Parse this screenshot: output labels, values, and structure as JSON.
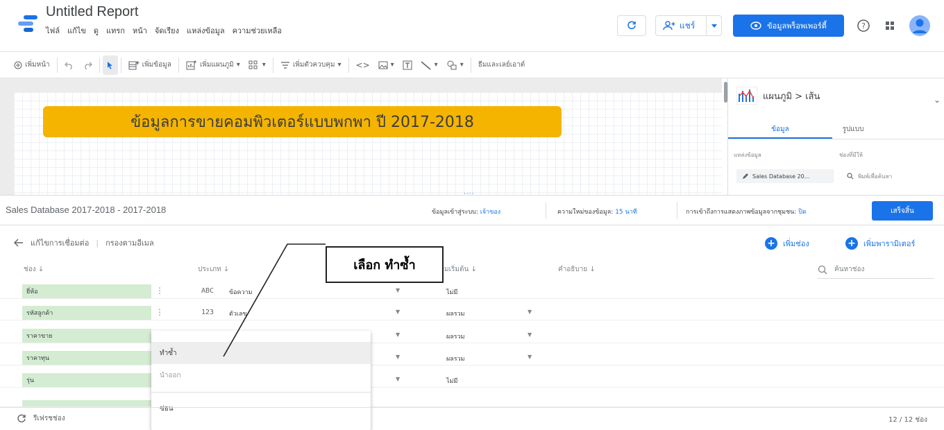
{
  "app": {
    "title": "Untitled Report"
  },
  "menu": [
    "ไฟล์",
    "แก้ไข",
    "ดู",
    "แทรก",
    "หน้า",
    "จัดเรียง",
    "แหล่งข้อมูล",
    "ความช่วยเหลือ"
  ],
  "header": {
    "share_label": "แชร์",
    "props_label": "ข้อมูลพร็อพเพอร์ตี้"
  },
  "toolbar": {
    "add_page": "เพิ่มหน้า",
    "add_data": "เพิ่มข้อมูล",
    "add_chart": "เพิ่มแผนภูมิ",
    "add_control": "เพิ่มตัวควบคุม",
    "theme_layout": "ธีมและเลย์เอาต์"
  },
  "canvas": {
    "banner_text": "ข้อมูลการขายคอมพิวเตอร์แบบพกพา ปี 2017-2018"
  },
  "right_panel": {
    "chart_breadcrumb": "แผนภูมิ > เส้น",
    "tab_data": "ข้อมูล",
    "tab_style": "รูปแบบ",
    "source_label": "แหล่งข้อมูล",
    "available_fields_label": "ช่องที่มีให้",
    "source_name": "Sales Database 20...",
    "search_placeholder": "พิมพ์เพื่อค้นหา"
  },
  "datasource": {
    "name": "Sales Database 2017-2018 - 2017-2018",
    "credentials_label": "ข้อมูลเข้าสู่ระบบ:",
    "credentials_value": "เจ้าของ",
    "freshness_label": "ความใหม่ของข้อมูล:",
    "freshness_value": "15 นาที",
    "community_label": "การเข้าถึงการแสดงภาพข้อมูลจากชุมชน:",
    "community_value": "ปิด",
    "done_label": "เสร็จสิ้น"
  },
  "editor": {
    "edit_connection": "แก้ไขการเชื่อมต่อ",
    "filter_email": "กรองตามอีเมล",
    "add_field": "เพิ่มช่อง",
    "add_parameter": "เพิ่มพารามิเตอร์",
    "search_fields": "ค้นหาช่อง"
  },
  "table": {
    "headers": {
      "field": "ช่อง",
      "type": "ประเภท",
      "default_agg": "การรวมเริ่มต้น",
      "description": "คำอธิบาย"
    },
    "rows": [
      {
        "name": "ยี่ห้อ",
        "type_code": "ABC",
        "type_name": "ข้อความ",
        "agg": "ไม่มี",
        "has_agg_drop": false
      },
      {
        "name": "รหัสลูกค้า",
        "type_code": "123",
        "type_name": "ตัวเลข",
        "agg": "ผลรวม",
        "has_agg_drop": true
      },
      {
        "name": "ราคาขาย",
        "type_code": "",
        "type_name": "",
        "agg": "ผลรวม",
        "has_agg_drop": true
      },
      {
        "name": "ราคาทุน",
        "type_code": "",
        "type_name": "",
        "agg": "ผลรวม",
        "has_agg_drop": true
      },
      {
        "name": "รุ่น",
        "type_code": "",
        "type_name": "",
        "agg": "ไม่มี",
        "has_agg_drop": false
      }
    ]
  },
  "context_menu": {
    "duplicate": "ทำซ้ำ",
    "export": "นำออก",
    "hide": "ซ่อน"
  },
  "annotation": {
    "callout": "เลือก ทำซ้ำ"
  },
  "footer": {
    "refresh_fields": "รีเฟรชช่อง",
    "count": "12 / 12 ช่อง"
  },
  "colors": {
    "accent": "#1a73e8",
    "banner": "#f4b400",
    "field_bg": "#d4ecd2"
  }
}
